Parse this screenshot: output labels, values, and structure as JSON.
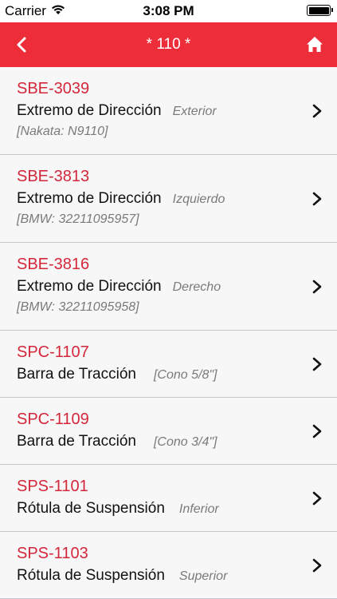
{
  "status": {
    "carrier": "Carrier",
    "time": "3:08 PM"
  },
  "nav": {
    "title": "* 110 *"
  },
  "colors": {
    "accent": "#ee2d3b",
    "code": "#d3273a"
  },
  "items": [
    {
      "code": "SBE-3039",
      "name": "Extremo de Dirección",
      "qualifier": "Exterior",
      "reference": "[Nakata: N9110]"
    },
    {
      "code": "SBE-3813",
      "name": "Extremo de Dirección",
      "qualifier": "Izquierdo",
      "reference": "[BMW: 32211095957]"
    },
    {
      "code": "SBE-3816",
      "name": "Extremo de Dirección",
      "qualifier": "Derecho",
      "reference": "[BMW: 32211095958]"
    },
    {
      "code": "SPC-1107",
      "name": "Barra de Tracción",
      "qualifier": "[Cono 5/8\"]"
    },
    {
      "code": "SPC-1109",
      "name": "Barra de Tracción",
      "qualifier": "[Cono 3/4\"]"
    },
    {
      "code": "SPS-1101",
      "name": "Rótula de Suspensión",
      "qualifier": "Inferior"
    },
    {
      "code": "SPS-1103",
      "name": "Rótula de Suspensión",
      "qualifier": "Superior"
    }
  ]
}
